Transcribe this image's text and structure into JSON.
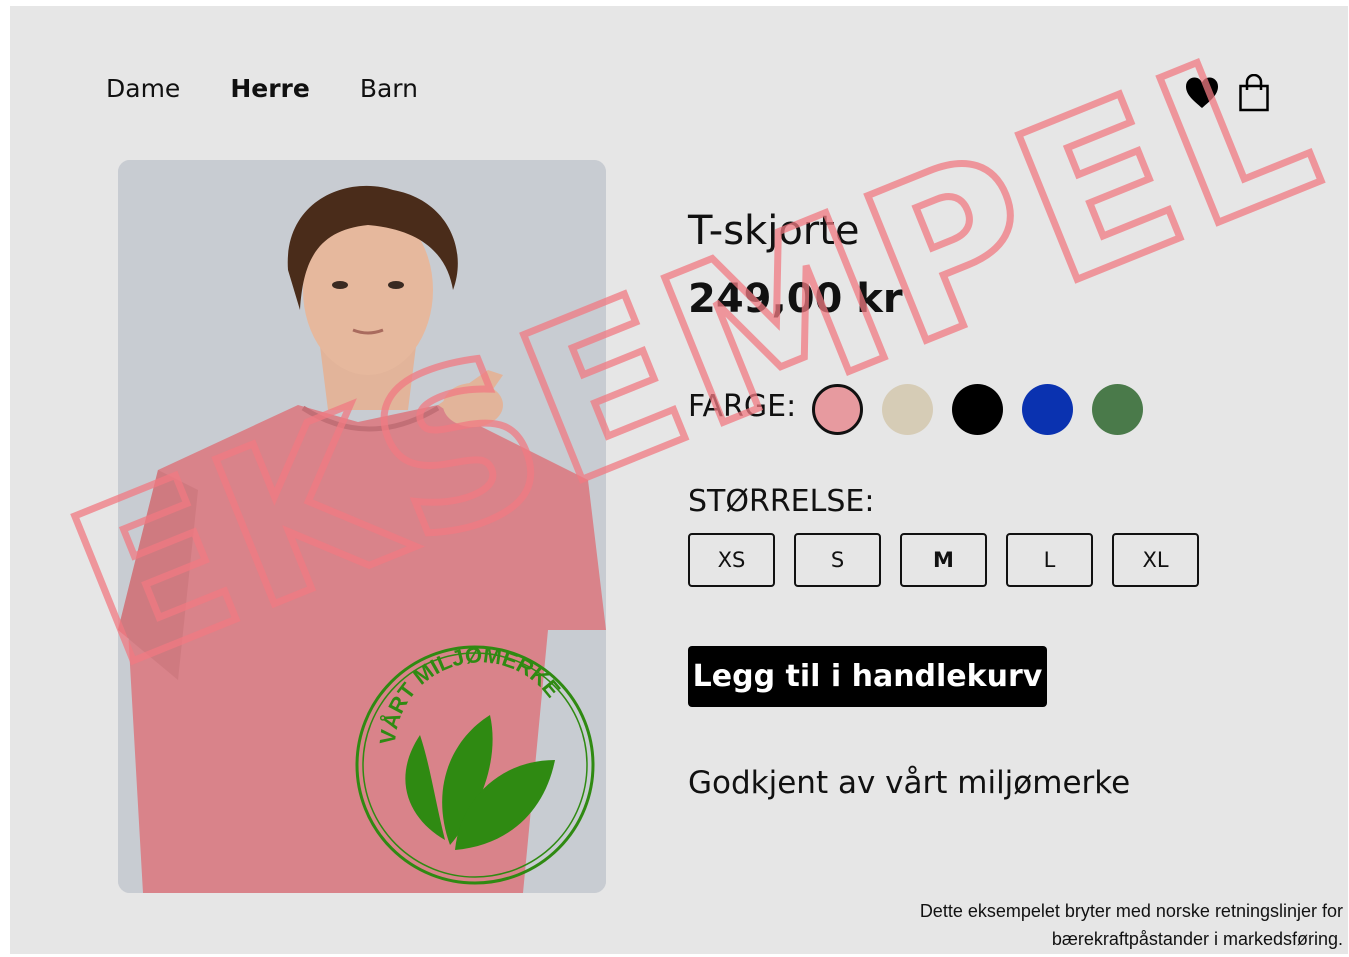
{
  "nav": {
    "items": [
      {
        "label": "Dame",
        "active": false
      },
      {
        "label": "Herre",
        "active": true
      },
      {
        "label": "Barn",
        "active": false
      }
    ]
  },
  "header_icons": [
    "heart-icon",
    "shopping-bag-icon"
  ],
  "product": {
    "title": "T-skjorte",
    "price": "249,00 kr",
    "color_label": "FARGE:",
    "colors": [
      {
        "name": "pink",
        "hex": "#e79a9f",
        "selected": true
      },
      {
        "name": "beige",
        "hex": "#d6ccb6",
        "selected": false
      },
      {
        "name": "black",
        "hex": "#000000",
        "selected": false
      },
      {
        "name": "blue",
        "hex": "#0a32b0",
        "selected": false
      },
      {
        "name": "green",
        "hex": "#4a7a4a",
        "selected": false
      }
    ],
    "size_label": "STØRRELSE:",
    "sizes": [
      "XS",
      "S",
      "M",
      "L",
      "XL"
    ],
    "selected_size": "M",
    "add_to_cart_label": "Legg til i handlekurv",
    "eco_claim": "Godkjent av vårt miljømerke"
  },
  "stamp": {
    "text": "VÅRT MILJØMERKE",
    "color": "#2f8a12"
  },
  "watermark": {
    "text": "EKSEMPEL",
    "color": "#f07a82"
  },
  "footnote": {
    "line1": "Dette eksempelet bryter med norske retningslinjer for",
    "line2": "bærekraftpåstander i markedsføring."
  }
}
